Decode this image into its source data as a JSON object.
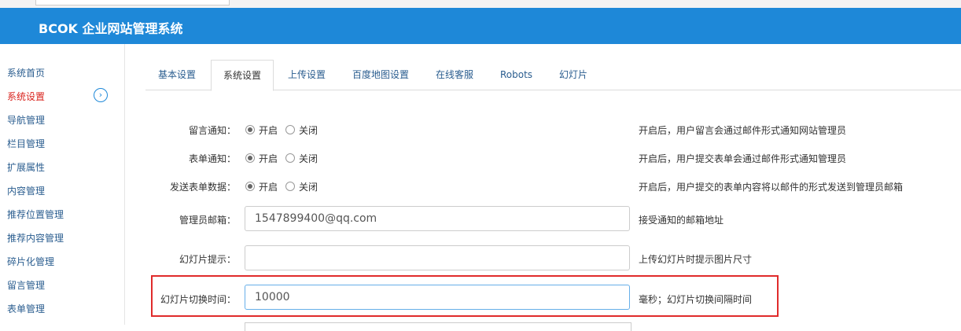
{
  "app": {
    "title": "BCOK 企业网站管理系统"
  },
  "sidebar": {
    "items": [
      {
        "label": "系统首页",
        "active": false
      },
      {
        "label": "系统设置",
        "active": true
      },
      {
        "label": "导航管理",
        "active": false
      },
      {
        "label": "栏目管理",
        "active": false
      },
      {
        "label": "扩展属性",
        "active": false
      },
      {
        "label": "内容管理",
        "active": false
      },
      {
        "label": "推荐位置管理",
        "active": false
      },
      {
        "label": "推荐内容管理",
        "active": false
      },
      {
        "label": "碎片化管理",
        "active": false
      },
      {
        "label": "留言管理",
        "active": false
      },
      {
        "label": "表单管理",
        "active": false
      }
    ]
  },
  "tabs": [
    {
      "label": "基本设置",
      "active": false
    },
    {
      "label": "系统设置",
      "active": true
    },
    {
      "label": "上传设置",
      "active": false
    },
    {
      "label": "百度地图设置",
      "active": false
    },
    {
      "label": "在线客服",
      "active": false
    },
    {
      "label": "Robots",
      "active": false
    },
    {
      "label": "幻灯片",
      "active": false
    }
  ],
  "form": {
    "message_notify": {
      "label": "留言通知：",
      "on": "开启",
      "off": "关闭",
      "selected": "on",
      "hint": "开启后，用户留言会通过邮件形式通知网站管理员"
    },
    "form_notify": {
      "label": "表单通知：",
      "on": "开启",
      "off": "关闭",
      "selected": "on",
      "hint": "开启后，用户提交表单会通过邮件形式通知管理员"
    },
    "send_form_data": {
      "label": "发送表单数据：",
      "on": "开启",
      "off": "关闭",
      "selected": "on",
      "hint": "开启后，用户提交的表单内容将以邮件的形式发送到管理员邮箱"
    },
    "admin_email": {
      "label": "管理员邮箱：",
      "value": "1547899400@qq.com",
      "hint": "接受通知的邮箱地址"
    },
    "slide_tip": {
      "label": "幻灯片提示：",
      "value": "",
      "hint": "上传幻灯片时提示图片尺寸"
    },
    "slide_interval": {
      "label": "幻灯片切换时间：",
      "value": "10000",
      "hint": "毫秒；幻灯片切换间隔时间"
    }
  },
  "colors": {
    "header": "#1e88d8",
    "active_nav": "#d9231d",
    "highlight": "#e02b2b"
  }
}
